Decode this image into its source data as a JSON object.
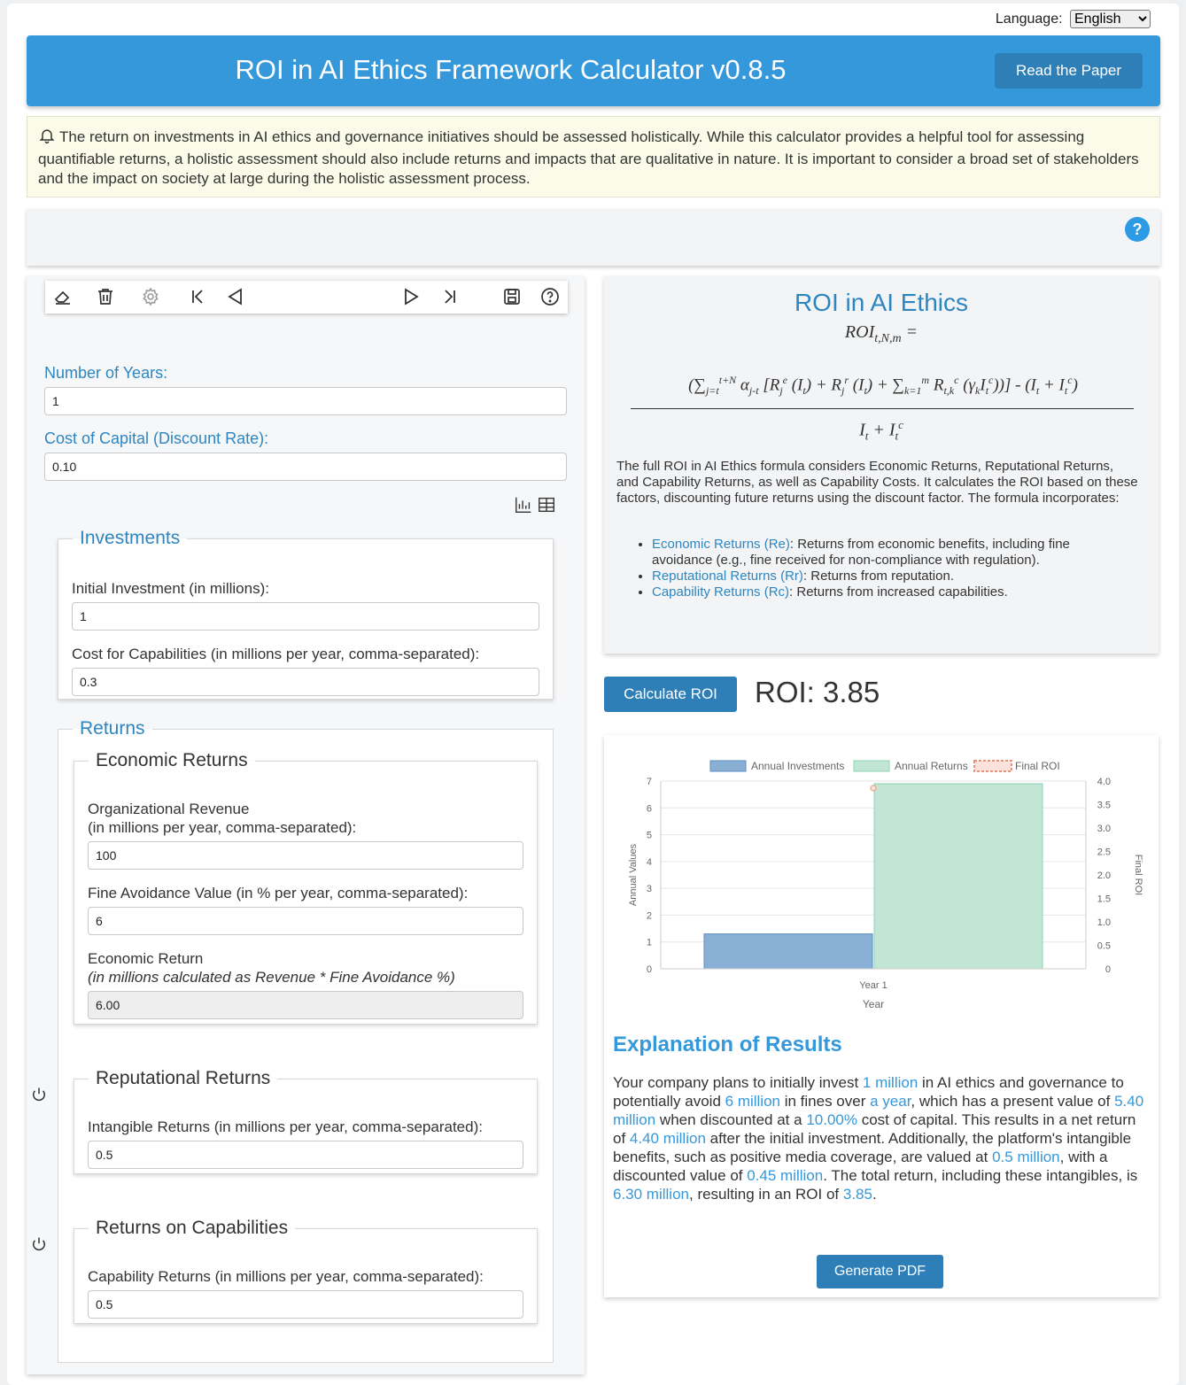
{
  "language": {
    "label": "Language:",
    "selected": "English"
  },
  "header": {
    "title": "ROI in AI Ethics Framework Calculator v0.8.5",
    "read_paper_label": "Read the Paper"
  },
  "notice": {
    "text": "The return on investments in AI ethics and governance initiatives should be assessed holistically. While this calculator provides a helpful tool for assessing quantifiable returns, a holistic assessment should also include returns and impacts that are qualitative in nature. It is important to consider a broad set of stakeholders and the impact on society at large during the holistic assessment process."
  },
  "help": {
    "symbol": "?"
  },
  "toolbar": {
    "icons": [
      "eraser-icon",
      "trash-icon",
      "gear-icon",
      "skip-first-icon",
      "previous-icon",
      "next-icon",
      "skip-last-icon",
      "save-icon",
      "help-icon"
    ]
  },
  "inputs": {
    "years_label": "Number of Years:",
    "years_value": "1",
    "cost_capital_label": "Cost of Capital (Discount Rate):",
    "cost_capital_value": "0.10"
  },
  "investments": {
    "title": "Investments",
    "initial_label": "Initial Investment (in millions):",
    "initial_value": "1",
    "capability_cost_label": "Cost for Capabilities (in millions per year, comma-separated):",
    "capability_cost_value": "0.3"
  },
  "returns": {
    "title": "Returns",
    "economic": {
      "title": "Economic Returns",
      "revenue_label_1": "Organizational Revenue",
      "revenue_label_2": "(in millions per year, comma-separated):",
      "revenue_value": "100",
      "fine_label": "Fine Avoidance Value (in % per year, comma-separated):",
      "fine_value": "6",
      "econ_label_1": "Economic Return",
      "econ_label_2": "(in millions calculated as Revenue * Fine Avoidance %)",
      "econ_value": "6.00"
    },
    "reputational": {
      "title": "Reputational Returns",
      "label": "Intangible Returns (in millions per year, comma-separated):",
      "value": "0.5"
    },
    "capabilities": {
      "title": "Returns on Capabilities",
      "label": "Capability Returns (in millions per year, comma-separated):",
      "value": "0.5"
    }
  },
  "formula": {
    "title": "ROI in AI Ethics",
    "lhs": "ROI",
    "lhs_sub": "t,N,m",
    "lhs_eq": " =",
    "description": "The full ROI in AI Ethics formula considers Economic Returns, Reputational Returns, and Capability Returns, as well as Capability Costs. It calculates the ROI based on these factors, discounting future returns using the discount factor. The formula incorporates:",
    "items": [
      {
        "term": "Economic Returns (Re)",
        "text": ": Returns from economic benefits, including fine avoidance (e.g., fine received for non-compliance with regulation)."
      },
      {
        "term": "Reputational Returns (Rr)",
        "text": ": Returns from reputation."
      },
      {
        "term": "Capability Returns (Rc)",
        "text": ": Returns from increased capabilities."
      }
    ]
  },
  "calc": {
    "button_label": "Calculate ROI",
    "roi_text": "ROI: 3.85"
  },
  "chart_data": {
    "type": "bar",
    "categories": [
      "Year 1"
    ],
    "series": [
      {
        "name": "Annual Investments",
        "values": [
          1.3
        ],
        "color": "#8aafd4"
      },
      {
        "name": "Annual Returns",
        "values": [
          6.9
        ],
        "color": "#c2e6d6"
      },
      {
        "name": "Final ROI",
        "values": [
          3.85
        ],
        "color": "#e8927c",
        "axis": "right"
      }
    ],
    "xlabel": "Year",
    "ylabel": "Annual Values",
    "y2label": "Final ROI",
    "ylim": [
      0,
      7
    ],
    "y_ticks": [
      "0",
      "1",
      "2",
      "3",
      "4",
      "5",
      "6",
      "7"
    ],
    "y2lim": [
      0,
      4
    ],
    "y2_ticks": [
      "0",
      "0.5",
      "1.0",
      "1.5",
      "2.0",
      "2.5",
      "3.0",
      "3.5",
      "4.0"
    ],
    "legend": "top"
  },
  "explanation": {
    "title": "Explanation of Results",
    "parts": [
      "Your company plans to initially invest ",
      "1 million",
      " in AI ethics and governance to potentially avoid ",
      "6 million",
      " in fines over ",
      "a year",
      ", which has a present value of ",
      "5.40 million",
      " when discounted at a ",
      "10.00%",
      " cost of capital. This results in a net return of ",
      "4.40 million",
      " after the initial investment. Additionally, the platform's intangible benefits, such as positive media coverage, are valued at ",
      "0.5 million",
      ", with a discounted value of ",
      "0.45 million",
      ". The total return, including these intangibles, is ",
      "6.30 million",
      ", resulting in an ROI of ",
      "3.85",
      "."
    ],
    "pdf_label": "Generate PDF"
  }
}
